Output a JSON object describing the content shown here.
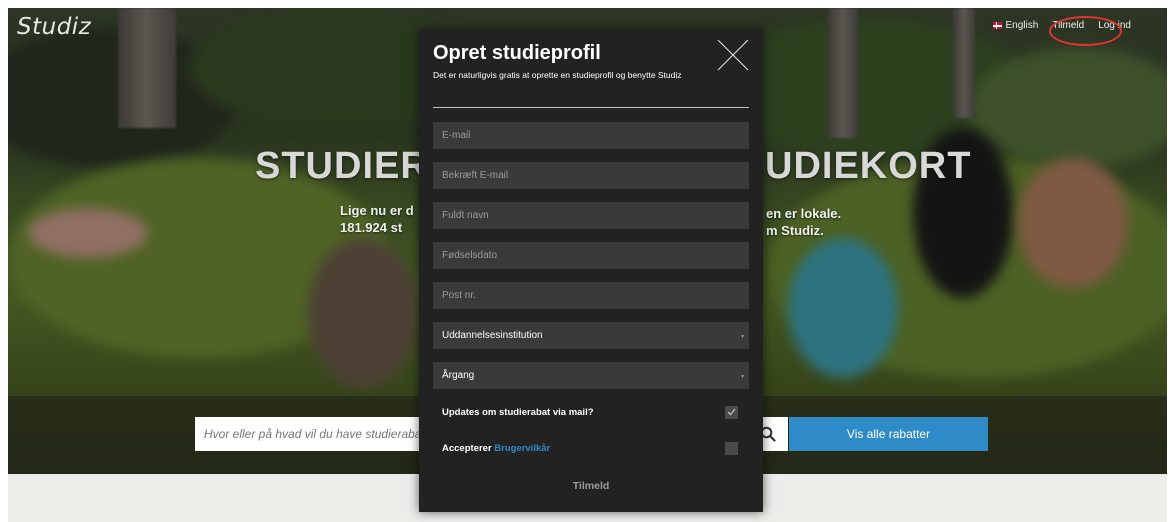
{
  "site": {
    "logo": "Studiz"
  },
  "topnav": {
    "language": "English",
    "signup": "Tilmeld",
    "login": "Log ind"
  },
  "hero": {
    "headline_left": "STUDIERA",
    "headline_right": "UDIEKORT",
    "sub_left_1": "Lige nu er d",
    "sub_left_2": "181.924 st",
    "sub_right_1": "en er lokale.",
    "sub_right_2": "m Studiz."
  },
  "search": {
    "placeholder": "Hvor eller på hvad vil du have studierabat?",
    "button_label": "Vis alle rabatter"
  },
  "modal": {
    "title": "Opret studieprofil",
    "subtitle": "Det er naturligvis gratis at oprette en studieprofil og benytte Studiz",
    "fields": {
      "email": "E-mail",
      "confirm_email": "Bekræft E-mail",
      "full_name": "Fuldt navn",
      "birthdate": "Fødselsdato",
      "postal": "Post nr."
    },
    "selects": {
      "institution": "Uddannelsesinstitution",
      "year": "Årgang"
    },
    "updates_label": "Updates om studierabat via mail?",
    "updates_checked": true,
    "accept_label": "Accepterer",
    "accept_link": "Brugervilkår",
    "accept_checked": false,
    "submit": "Tilmeld"
  },
  "colors": {
    "accent": "#2f8bc7",
    "modal_bg": "#222222",
    "field_bg": "#3a3a3a",
    "highlight_ring": "#e5312f"
  }
}
